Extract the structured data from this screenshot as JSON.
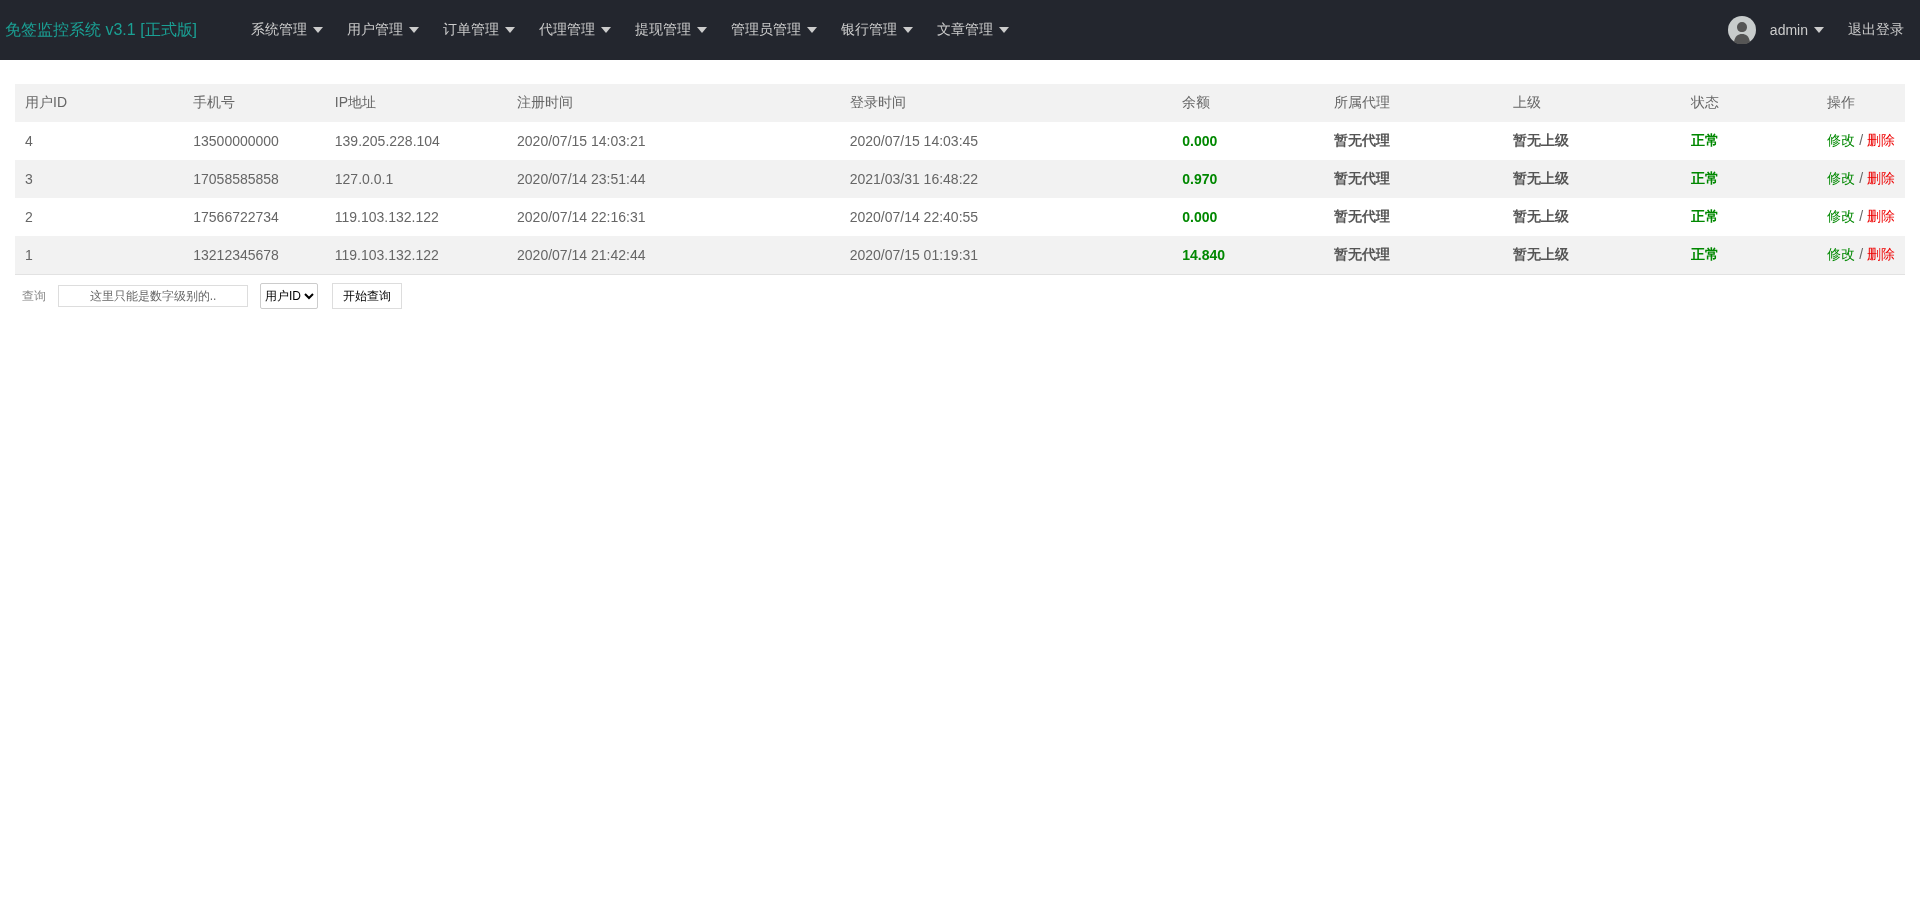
{
  "navbar": {
    "brand": "免签监控系统 v3.1 [正式版]",
    "menus": [
      "系统管理",
      "用户管理",
      "订单管理",
      "代理管理",
      "提现管理",
      "管理员管理",
      "银行管理",
      "文章管理"
    ],
    "user": "admin",
    "logout": "退出登录"
  },
  "table": {
    "columns": [
      "用户ID",
      "手机号",
      "IP地址",
      "注册时间",
      "登录时间",
      "余额",
      "所属代理",
      "上级",
      "状态",
      "操作"
    ],
    "rows": [
      {
        "id": "4",
        "phone": "13500000000",
        "ip": "139.205.228.104",
        "registered": "2020/07/15 14:03:21",
        "login": "2020/07/15 14:03:45",
        "balance": "0.000",
        "agent": "暂无代理",
        "parent": "暂无上级",
        "status": "正常",
        "edit": "修改",
        "separator": "/",
        "delete": "删除"
      },
      {
        "id": "3",
        "phone": "17058585858",
        "ip": "127.0.0.1",
        "registered": "2020/07/14 23:51:44",
        "login": "2021/03/31 16:48:22",
        "balance": "0.970",
        "agent": "暂无代理",
        "parent": "暂无上级",
        "status": "正常",
        "edit": "修改",
        "separator": "/",
        "delete": "删除"
      },
      {
        "id": "2",
        "phone": "17566722734",
        "ip": "119.103.132.122",
        "registered": "2020/07/14 22:16:31",
        "login": "2020/07/14 22:40:55",
        "balance": "0.000",
        "agent": "暂无代理",
        "parent": "暂无上级",
        "status": "正常",
        "edit": "修改",
        "separator": "/",
        "delete": "删除"
      },
      {
        "id": "1",
        "phone": "13212345678",
        "ip": "119.103.132.122",
        "registered": "2020/07/14 21:42:44",
        "login": "2020/07/15 01:19:31",
        "balance": "14.840",
        "agent": "暂无代理",
        "parent": "暂无上级",
        "status": "正常",
        "edit": "修改",
        "separator": "/",
        "delete": "删除"
      }
    ]
  },
  "search": {
    "label": "查询",
    "placeholder": "这里只能是数字级别的..",
    "field": "用户ID",
    "button": "开始查询"
  }
}
